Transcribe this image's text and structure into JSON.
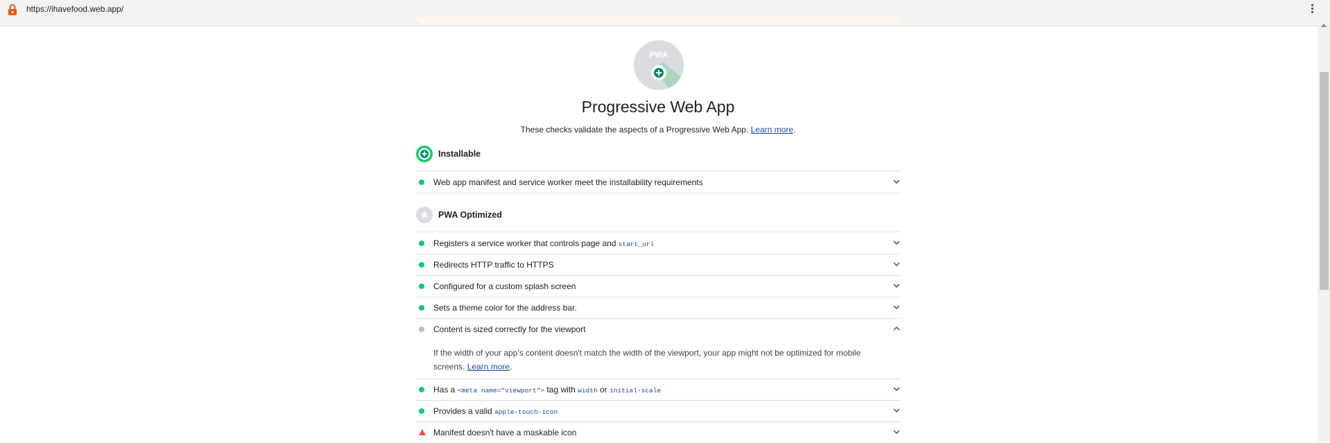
{
  "browser": {
    "url": "https://ihavefood.web.app/",
    "lock_icon": "lock-icon",
    "menu_icon": "kebab-menu-icon"
  },
  "category": {
    "badge_text": "PWA",
    "title": "Progressive Web App",
    "description": "These checks validate the aspects of a Progressive Web App. ",
    "learn_more": "Learn more",
    "period": "."
  },
  "groups": {
    "installable": {
      "title": "Installable",
      "icon": "plus-circle-icon",
      "color": "#0cce6b"
    },
    "optimized": {
      "title": "PWA Optimized",
      "icon": "star-circle-icon",
      "color": "#dadce0"
    }
  },
  "audits": {
    "installable": {
      "title": "Web app manifest and service worker meet the installability requirements",
      "status": "pass"
    },
    "service_worker": {
      "title": "Registers a service worker that controls page and ",
      "code": "start_url",
      "status": "pass"
    },
    "redirects": {
      "title": "Redirects HTTP traffic to HTTPS",
      "status": "pass"
    },
    "splash": {
      "title": "Configured for a custom splash screen",
      "status": "pass"
    },
    "theme": {
      "title": "Sets a theme color for the address bar.",
      "status": "pass"
    },
    "content_width": {
      "title": "Content is sized correctly for the viewport",
      "status": "informative",
      "expanded": true,
      "description": "If the width of your app's content doesn't match the width of the viewport, your app might not be optimized for mobile screens. ",
      "learn_more": "Learn more",
      "period": "."
    },
    "viewport": {
      "t1": "Has a ",
      "c1": "<meta name=\"viewport\">",
      "t2": " tag with ",
      "c2": "width",
      "t3": " or ",
      "c3": "initial-scale",
      "status": "pass"
    },
    "apple_icon": {
      "title": "Provides a valid ",
      "code": "apple-touch-icon",
      "status": "pass"
    },
    "maskable": {
      "title": "Manifest doesn't have a maskable icon",
      "status": "fail"
    }
  },
  "colors": {
    "pass": "#0cce6b",
    "fail": "#ff4e42",
    "informative": "#bdbdbd",
    "link": "#1a47b5"
  }
}
